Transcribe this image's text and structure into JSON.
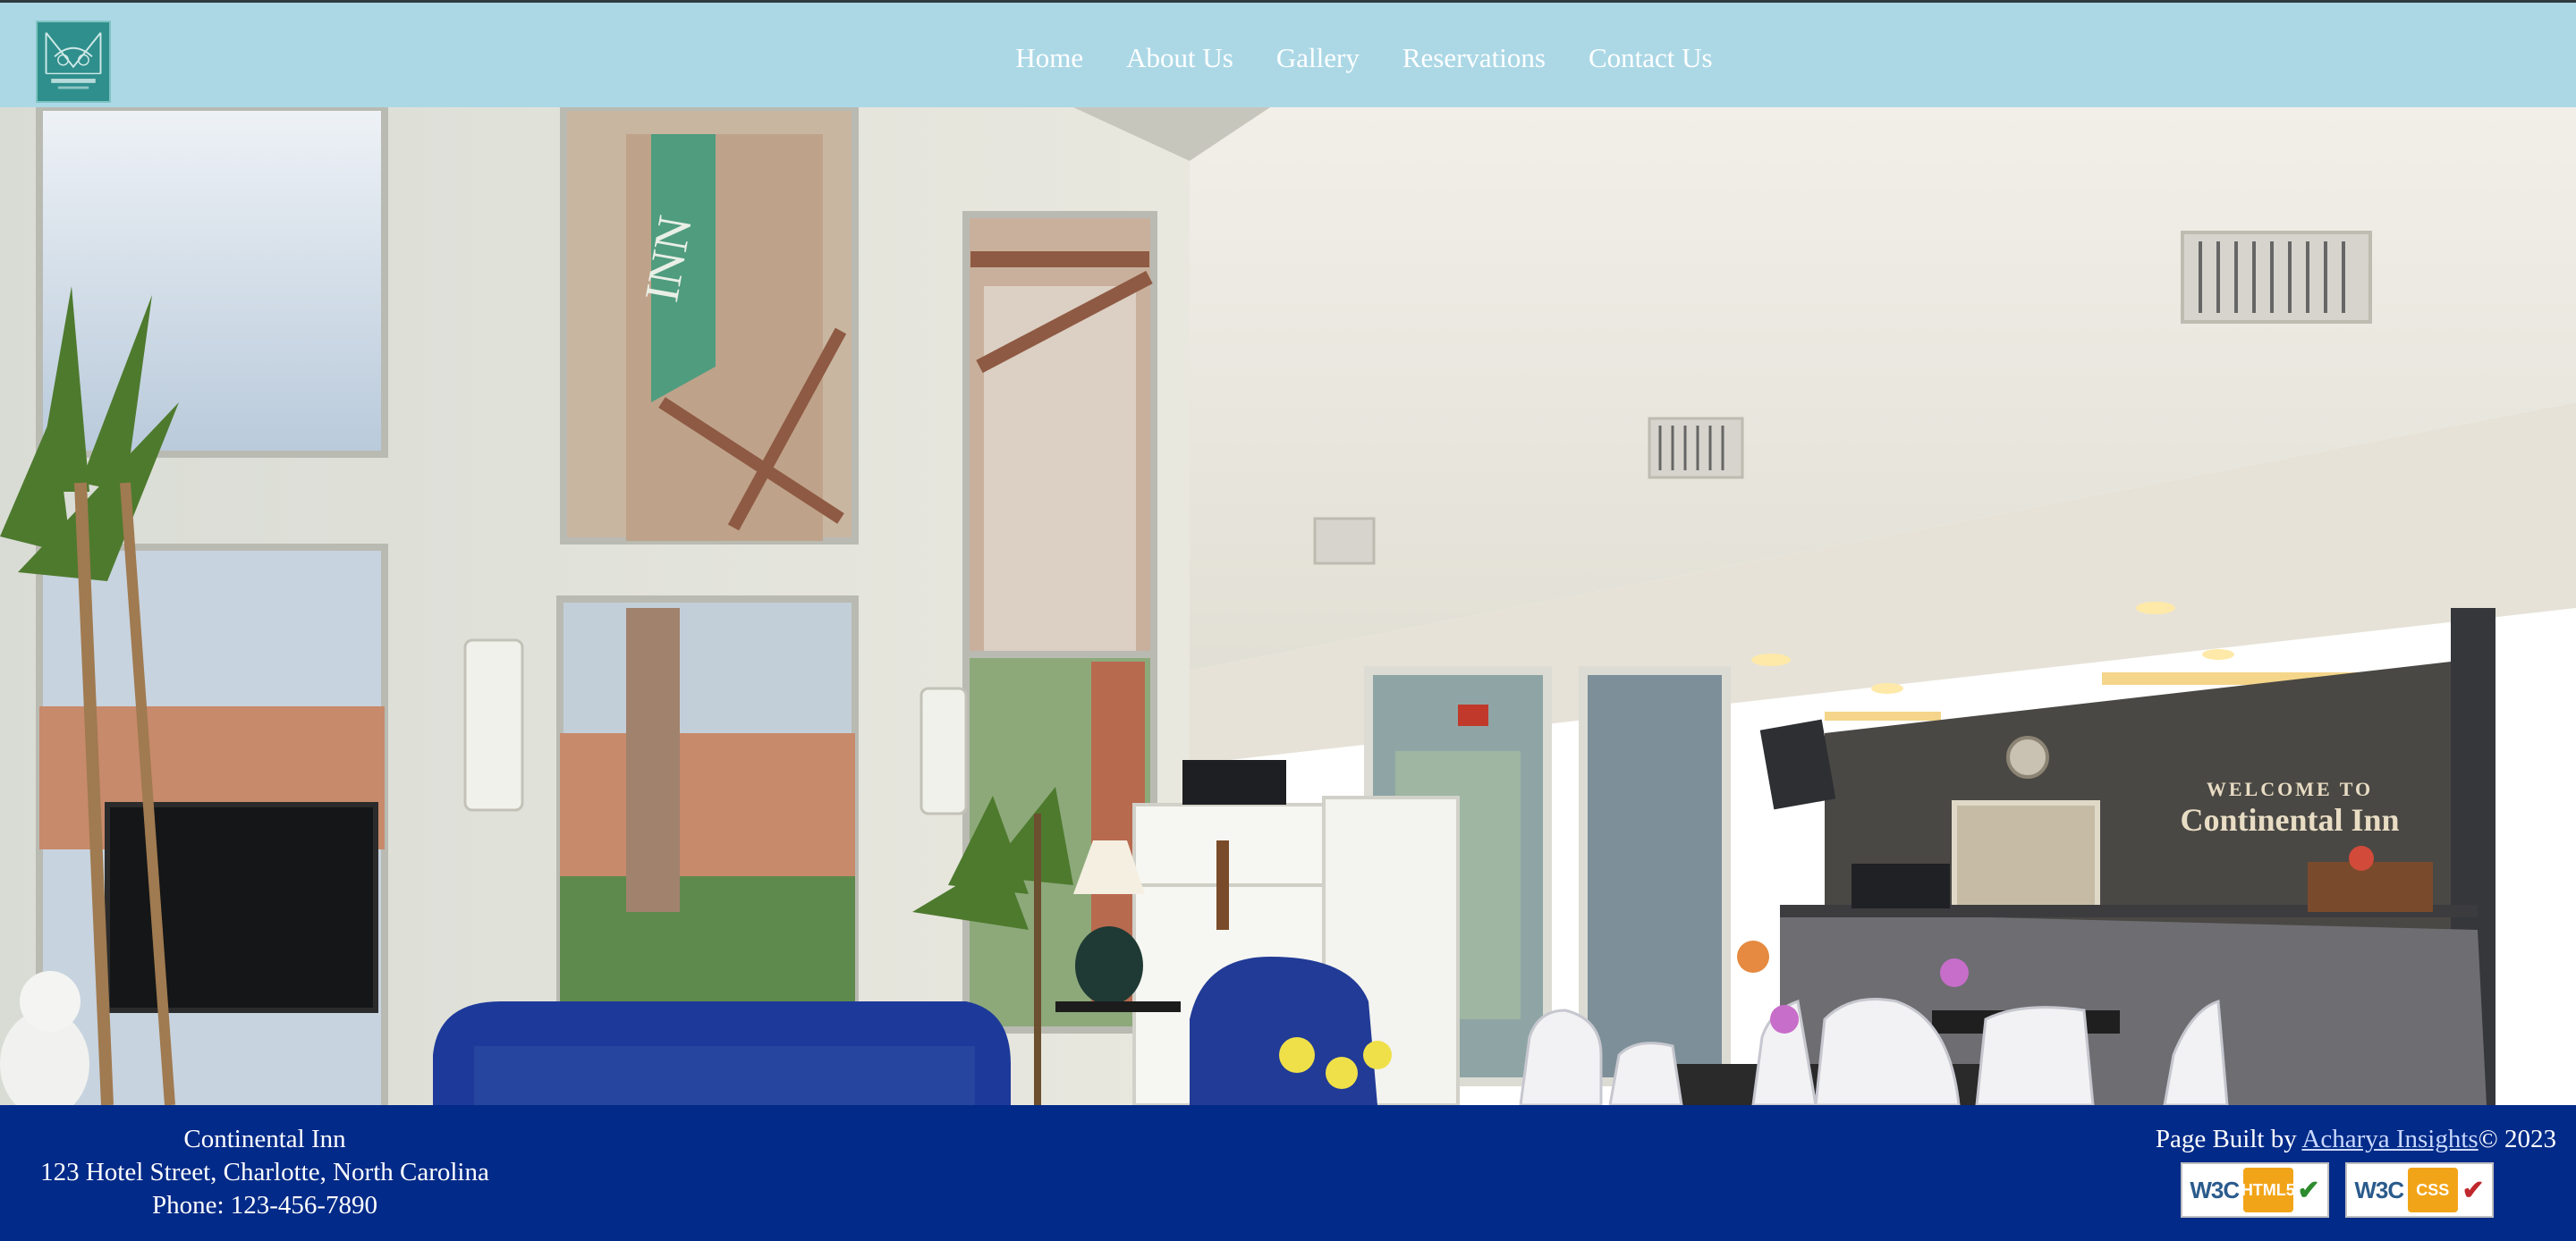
{
  "brand": {
    "logo_alt": "continental-inn-logo",
    "logo_text": "continental inn"
  },
  "nav": {
    "items": [
      {
        "label": "Home"
      },
      {
        "label": "About Us"
      },
      {
        "label": "Gallery"
      },
      {
        "label": "Reservations"
      },
      {
        "label": "Contact Us"
      }
    ]
  },
  "hero": {
    "image_subject": "hotel lobby interior",
    "sign_line1": "WELCOME TO",
    "sign_line2": "Continental Inn"
  },
  "footer": {
    "name": "Continental Inn",
    "address": "123 Hotel Street, Charlotte, North Carolina",
    "phone": "Phone: 123-456-7890",
    "built_by_prefix": "Page Built by ",
    "built_by_link": "Acharya Insights",
    "copyright": "© 2023",
    "badges": [
      {
        "org": "W3C",
        "mark": "HTML5",
        "icon": "html5-icon"
      },
      {
        "org": "W3C",
        "mark": "CSS",
        "icon": "css-icon"
      }
    ]
  },
  "colors": {
    "header_bg": "#acd8e6",
    "footer_bg": "#022a88",
    "nav_text": "#ffffff",
    "logo_bg": "#2f8f8c"
  }
}
